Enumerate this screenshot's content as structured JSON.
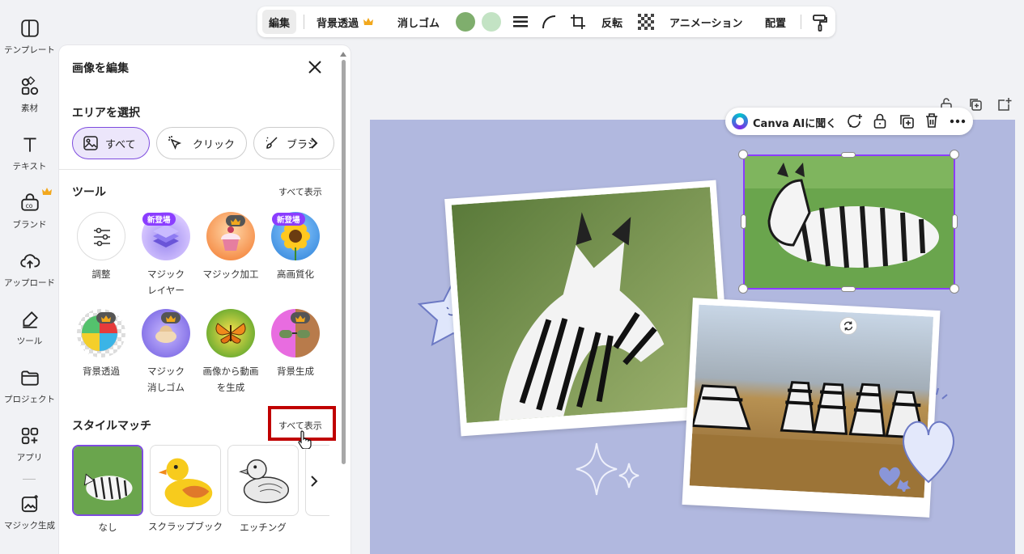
{
  "rail": {
    "items": [
      {
        "label": "テンプレート",
        "icon": "layout-icon"
      },
      {
        "label": "素材",
        "icon": "elements-icon"
      },
      {
        "label": "テキスト",
        "icon": "text-icon"
      },
      {
        "label": "ブランド",
        "icon": "brand-icon"
      },
      {
        "label": "アップロード",
        "icon": "upload-icon"
      },
      {
        "label": "ツール",
        "icon": "pen-tool-icon"
      },
      {
        "label": "プロジェクト",
        "icon": "folder-icon"
      },
      {
        "label": "アプリ",
        "icon": "apps-icon"
      },
      {
        "label": "マジック生成",
        "icon": "magic-media-icon"
      }
    ]
  },
  "panel": {
    "title": "画像を編集",
    "area": {
      "title": "エリアを選択",
      "options": [
        "すべて",
        "クリック",
        "ブラシ"
      ]
    },
    "tools": {
      "title": "ツール",
      "show_all": "すべて表示",
      "items": [
        {
          "label": "調整",
          "badge": ""
        },
        {
          "label": "マジック\nレイヤー",
          "badge": "新登場"
        },
        {
          "label": "マジック加工",
          "badge": "crown"
        },
        {
          "label": "高画質化",
          "badge": "新登場"
        },
        {
          "label": "背景透過",
          "badge": "crown"
        },
        {
          "label": "マジック\n消しゴム",
          "badge": "crown"
        },
        {
          "label": "画像から動画\nを生成",
          "badge": ""
        },
        {
          "label": "背景生成",
          "badge": "crown"
        }
      ]
    },
    "style_match": {
      "title": "スタイルマッチ",
      "show_all": "すべて表示",
      "items": [
        "なし",
        "スクラップブック",
        "エッチング"
      ]
    }
  },
  "toolbar": {
    "edit": "編集",
    "bg_remove": "背景透過",
    "eraser": "消しゴム",
    "flip": "反転",
    "animation": "アニメーション",
    "position": "配置",
    "colors": [
      "#7fae6d",
      "#c3e3c4"
    ]
  },
  "canvas": {
    "ai_button": "Canva AIに聞く",
    "background": "#b1b8df"
  }
}
